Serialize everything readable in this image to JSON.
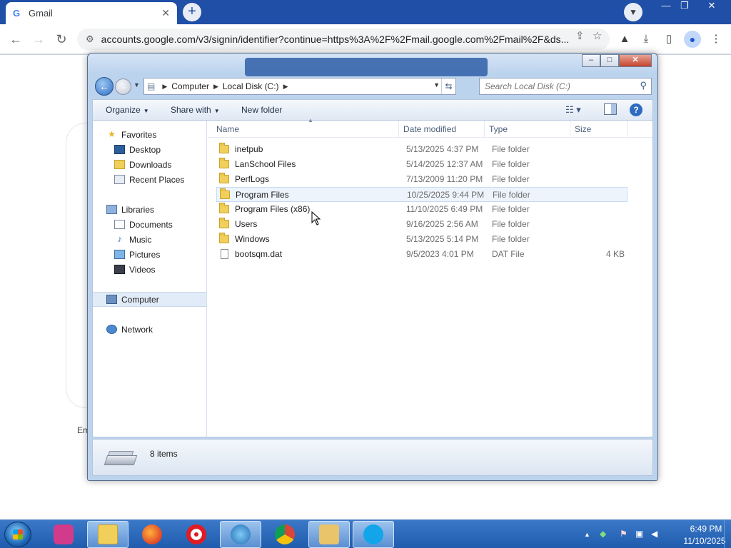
{
  "browser": {
    "tab_title": "Gmail",
    "tab_icon": "G",
    "url": "accounts.google.com/v3/signin/identifier?continue=https%3A%2F%2Fmail.google.com%2Fmail%2F&ds..."
  },
  "page_behind": {
    "partial_text": "Em"
  },
  "explorer": {
    "breadcrumbs": [
      "Computer",
      "Local Disk (C:)"
    ],
    "search_placeholder": "Search Local Disk (C:)",
    "commands": {
      "organize": "Organize",
      "share_with": "Share with",
      "new_folder": "New folder"
    },
    "nav": {
      "favorites": "Favorites",
      "favorites_items": [
        "Desktop",
        "Downloads",
        "Recent Places"
      ],
      "libraries": "Libraries",
      "libraries_items": [
        "Documents",
        "Music",
        "Pictures",
        "Videos"
      ],
      "computer": "Computer",
      "network": "Network"
    },
    "columns": {
      "name": "Name",
      "date": "Date modified",
      "type": "Type",
      "size": "Size"
    },
    "files": [
      {
        "name": "inetpub",
        "date": "5/13/2025 4:37 PM",
        "type": "File folder",
        "size": "",
        "icon": "folder-icon"
      },
      {
        "name": "LanSchool Files",
        "date": "5/14/2025 12:37 AM",
        "type": "File folder",
        "size": "",
        "icon": "folder-icon"
      },
      {
        "name": "PerfLogs",
        "date": "7/13/2009 11:20 PM",
        "type": "File folder",
        "size": "",
        "icon": "folder-icon"
      },
      {
        "name": "Program Files",
        "date": "10/25/2025 9:44 PM",
        "type": "File folder",
        "size": "",
        "icon": "folder-icon"
      },
      {
        "name": "Program Files (x86)",
        "date": "11/10/2025 6:49 PM",
        "type": "File folder",
        "size": "",
        "icon": "folder-icon"
      },
      {
        "name": "Users",
        "date": "9/16/2025 2:56 AM",
        "type": "File folder",
        "size": "",
        "icon": "folder-icon"
      },
      {
        "name": "Windows",
        "date": "5/13/2025 5:14 PM",
        "type": "File folder",
        "size": "",
        "icon": "folder-icon"
      },
      {
        "name": "bootsqm.dat",
        "date": "9/5/2023 4:01 PM",
        "type": "DAT File",
        "size": "4 KB",
        "icon": "file-icon"
      }
    ],
    "status": "8 items"
  },
  "taskbar": {
    "time": "6:49 PM",
    "date": "11/10/2025"
  }
}
